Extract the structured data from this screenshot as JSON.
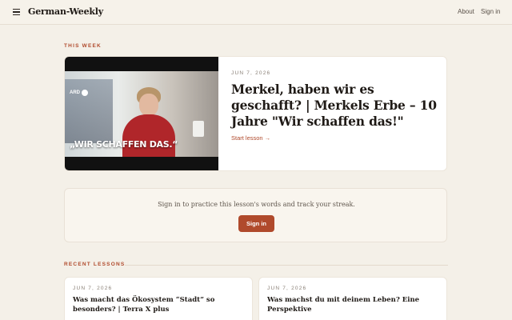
{
  "header": {
    "brand": "German-Weekly",
    "nav": {
      "about": "About",
      "signin": "Sign in"
    }
  },
  "this_week": {
    "label": "THIS WEEK",
    "thumbnail": {
      "caption": "„WIR SCHAFFEN DAS.“",
      "logo": "ARD"
    },
    "date": "JUN 7, 2026",
    "title": "Merkel, haben wir es geschafft? | Merkels Erbe – 10 Jahre \"Wir schaffen das!\"",
    "link": "Start lesson →"
  },
  "signin_prompt": {
    "text": "Sign in to practice this lesson's words and track your streak.",
    "button": "Sign in"
  },
  "recent": {
    "label": "RECENT LESSONS",
    "items": [
      {
        "date": "JUN 7, 2026",
        "title": "Was macht das Ökosystem “Stadt” so besonders? | Terra X plus"
      },
      {
        "date": "JUN 7, 2026",
        "title": "Was machst du mit deinem Leben? Eine Perspektive"
      }
    ]
  },
  "colors": {
    "accent": "#b04a2c",
    "background": "#f4f0e8",
    "card": "#ffffff"
  },
  "icons": {
    "menu": "hamburger-menu-icon"
  }
}
